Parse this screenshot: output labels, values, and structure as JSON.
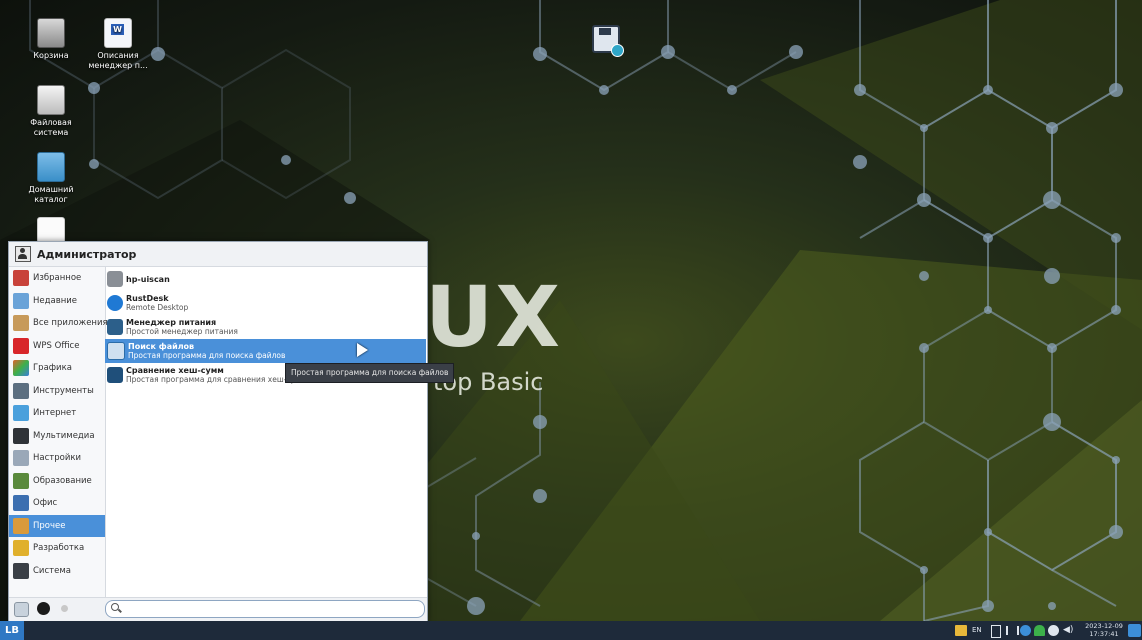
{
  "desktop": {
    "icons": [
      {
        "label": "Корзина",
        "icon": "trash-icon"
      },
      {
        "label": "Описания менеджер п...",
        "icon": "document-icon"
      },
      {
        "label": "Файловая система",
        "icon": "drive-icon"
      },
      {
        "label": "Домашний каталог",
        "icon": "home-folder-icon"
      },
      {
        "label": "",
        "icon": "file-icon"
      }
    ],
    "wallpaper_title": "UX",
    "wallpaper_subtitle": "top Basic",
    "floppy_icon": "save-floppy-icon"
  },
  "menu": {
    "user": "Администратор",
    "categories": [
      {
        "label": "Избранное",
        "color": "#c8423a"
      },
      {
        "label": "Недавние",
        "color": "#6aa3d8"
      },
      {
        "label": "Все приложения",
        "color": "#c79a5a"
      },
      {
        "label": "WPS Office",
        "color": "#d8262a"
      },
      {
        "label": "Графика",
        "color": "#e0642c"
      },
      {
        "label": "Инструменты",
        "color": "#5c6f80"
      },
      {
        "label": "Интернет",
        "color": "#4aa0dc"
      },
      {
        "label": "Мультимедиа",
        "color": "#2f3338"
      },
      {
        "label": "Настройки",
        "color": "#9aa8b8"
      },
      {
        "label": "Образование",
        "color": "#5a8a3c"
      },
      {
        "label": "Офис",
        "color": "#3c6fb0"
      },
      {
        "label": "Прочее",
        "color": "#d99a3c"
      },
      {
        "label": "Разработка",
        "color": "#e0b02c"
      },
      {
        "label": "Система",
        "color": "#3a3f46"
      }
    ],
    "selected_category": "Прочее",
    "apps": [
      {
        "name": "hp-uiscan",
        "desc": "",
        "color": "#8a8f96"
      },
      {
        "name": "RustDesk",
        "desc": "Remote Desktop",
        "color": "#1f79d4"
      },
      {
        "name": "Менеджер питания",
        "desc": "Простой менеджер питания",
        "color": "#2c5f8a"
      },
      {
        "name": "Поиск файлов",
        "desc": "Простая программа для поиска файлов",
        "color": "#2b6ca8"
      },
      {
        "name": "Сравнение хеш-сумм",
        "desc": "Простая программа для сравнения хеш-сум",
        "color": "#1f4f7a"
      }
    ],
    "selected_app": "Поиск файлов",
    "tooltip": "Простая программа для поиска файлов",
    "search": {
      "value": ""
    }
  },
  "taskbar": {
    "start_label": "LB",
    "language": "EN",
    "clock_date": "2023-12-09",
    "clock_time": "17:37:41"
  }
}
